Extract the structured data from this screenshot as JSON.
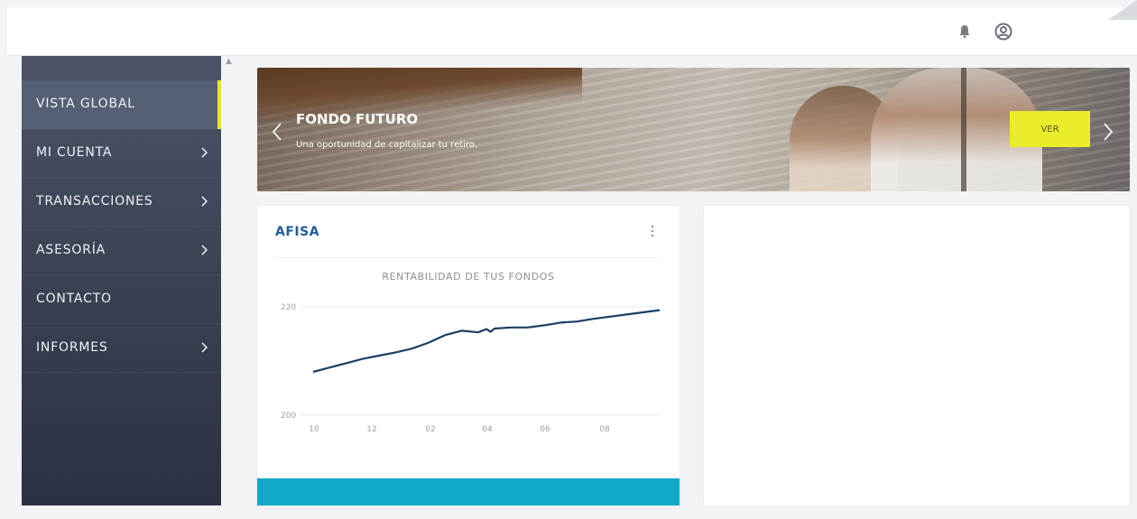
{
  "topbar": {
    "icons": [
      "bell-icon",
      "user-circle-icon"
    ]
  },
  "sidebar": {
    "accent_color": "#e6e62f",
    "items": [
      {
        "label": "VISTA GLOBAL",
        "active": true,
        "has_chevron": false
      },
      {
        "label": "MI CUENTA",
        "active": false,
        "has_chevron": true
      },
      {
        "label": "TRANSACCIONES",
        "active": false,
        "has_chevron": true
      },
      {
        "label": "ASESORÍA",
        "active": false,
        "has_chevron": true
      },
      {
        "label": "CONTACTO",
        "active": false,
        "has_chevron": false
      },
      {
        "label": "INFORMES",
        "active": false,
        "has_chevron": true
      }
    ]
  },
  "banner": {
    "title": "FONDO FUTURO",
    "subtitle": "Una oportunidad de capitalizar tu retiro.",
    "button_label": "VER",
    "button_color": "#ebec2a"
  },
  "card": {
    "title": "AFISA",
    "title_color": "#1f5d99",
    "footer_color": "#12a9c9"
  },
  "chart_data": {
    "type": "line",
    "title": "RENTABILIDAD DE TUS FONDOS",
    "xlabel": "",
    "ylabel": "",
    "x_ticks": [
      "10",
      "12",
      "02",
      "04",
      "06",
      "08"
    ],
    "y_ticks": [
      "220",
      "200"
    ],
    "ylim": [
      200,
      220
    ],
    "line_color": "#1d3f66",
    "grid": true,
    "series": [
      {
        "x": [
          0,
          2,
          4,
          6,
          8,
          10,
          12,
          14,
          16,
          18,
          20,
          21,
          21.5,
          22,
          24,
          26,
          28,
          30,
          32,
          34,
          36,
          38,
          40,
          42
        ],
        "values": [
          208.0,
          208.8,
          209.6,
          210.4,
          211.0,
          211.6,
          212.3,
          213.4,
          214.8,
          215.6,
          215.3,
          215.9,
          215.4,
          216.0,
          216.2,
          216.2,
          216.6,
          217.1,
          217.3,
          217.8,
          218.2,
          218.6,
          219.0,
          219.4
        ]
      }
    ]
  }
}
